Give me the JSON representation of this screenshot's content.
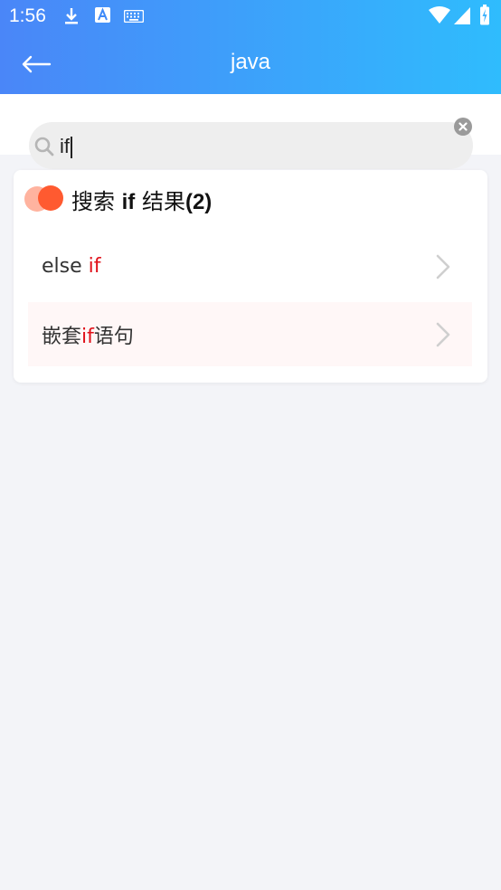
{
  "status_bar": {
    "time": "1:56",
    "icons": [
      "download-icon",
      "text-a-icon",
      "keyboard-icon",
      "wifi-icon",
      "signal-icon",
      "battery-icon"
    ]
  },
  "app_bar": {
    "title": "java",
    "back_icon": "back-arrow-icon"
  },
  "search": {
    "value": "if",
    "icon": "search-icon",
    "clear_icon": "clear-icon"
  },
  "results": {
    "prefix": "搜索",
    "keyword": "if",
    "suffix": "结果",
    "count": "(2)",
    "items": [
      {
        "pre": "else ",
        "match": "if",
        "post": ""
      },
      {
        "pre": "嵌套",
        "match": "if",
        "post": "语句"
      }
    ]
  },
  "colors": {
    "header_gradient_start": "#4a86f8",
    "header_gradient_end": "#2fbcfd",
    "highlight": "#e0111a",
    "accent_dot": "#ff5a30"
  }
}
